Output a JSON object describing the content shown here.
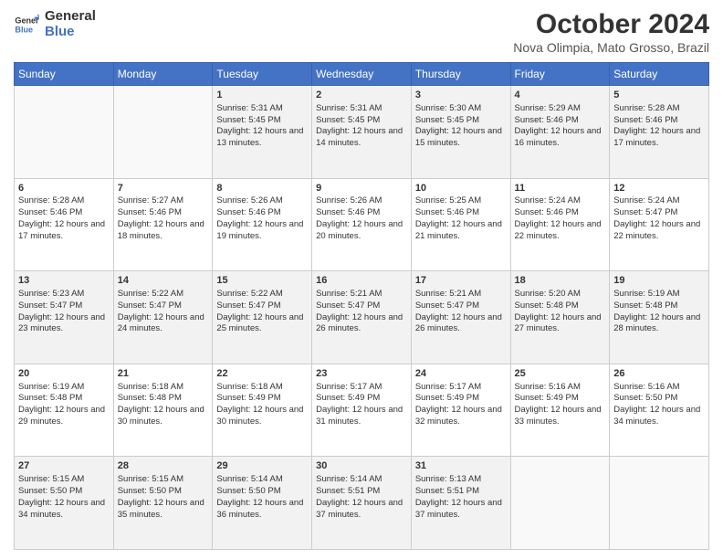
{
  "header": {
    "logo_line1": "General",
    "logo_line2": "Blue",
    "main_title": "October 2024",
    "subtitle": "Nova Olimpia, Mato Grosso, Brazil"
  },
  "days_of_week": [
    "Sunday",
    "Monday",
    "Tuesday",
    "Wednesday",
    "Thursday",
    "Friday",
    "Saturday"
  ],
  "weeks": [
    [
      {
        "day": "",
        "info": ""
      },
      {
        "day": "",
        "info": ""
      },
      {
        "day": "1",
        "info": "Sunrise: 5:31 AM\nSunset: 5:45 PM\nDaylight: 12 hours and 13 minutes."
      },
      {
        "day": "2",
        "info": "Sunrise: 5:31 AM\nSunset: 5:45 PM\nDaylight: 12 hours and 14 minutes."
      },
      {
        "day": "3",
        "info": "Sunrise: 5:30 AM\nSunset: 5:45 PM\nDaylight: 12 hours and 15 minutes."
      },
      {
        "day": "4",
        "info": "Sunrise: 5:29 AM\nSunset: 5:46 PM\nDaylight: 12 hours and 16 minutes."
      },
      {
        "day": "5",
        "info": "Sunrise: 5:28 AM\nSunset: 5:46 PM\nDaylight: 12 hours and 17 minutes."
      }
    ],
    [
      {
        "day": "6",
        "info": "Sunrise: 5:28 AM\nSunset: 5:46 PM\nDaylight: 12 hours and 17 minutes."
      },
      {
        "day": "7",
        "info": "Sunrise: 5:27 AM\nSunset: 5:46 PM\nDaylight: 12 hours and 18 minutes."
      },
      {
        "day": "8",
        "info": "Sunrise: 5:26 AM\nSunset: 5:46 PM\nDaylight: 12 hours and 19 minutes."
      },
      {
        "day": "9",
        "info": "Sunrise: 5:26 AM\nSunset: 5:46 PM\nDaylight: 12 hours and 20 minutes."
      },
      {
        "day": "10",
        "info": "Sunrise: 5:25 AM\nSunset: 5:46 PM\nDaylight: 12 hours and 21 minutes."
      },
      {
        "day": "11",
        "info": "Sunrise: 5:24 AM\nSunset: 5:46 PM\nDaylight: 12 hours and 22 minutes."
      },
      {
        "day": "12",
        "info": "Sunrise: 5:24 AM\nSunset: 5:47 PM\nDaylight: 12 hours and 22 minutes."
      }
    ],
    [
      {
        "day": "13",
        "info": "Sunrise: 5:23 AM\nSunset: 5:47 PM\nDaylight: 12 hours and 23 minutes."
      },
      {
        "day": "14",
        "info": "Sunrise: 5:22 AM\nSunset: 5:47 PM\nDaylight: 12 hours and 24 minutes."
      },
      {
        "day": "15",
        "info": "Sunrise: 5:22 AM\nSunset: 5:47 PM\nDaylight: 12 hours and 25 minutes."
      },
      {
        "day": "16",
        "info": "Sunrise: 5:21 AM\nSunset: 5:47 PM\nDaylight: 12 hours and 26 minutes."
      },
      {
        "day": "17",
        "info": "Sunrise: 5:21 AM\nSunset: 5:47 PM\nDaylight: 12 hours and 26 minutes."
      },
      {
        "day": "18",
        "info": "Sunrise: 5:20 AM\nSunset: 5:48 PM\nDaylight: 12 hours and 27 minutes."
      },
      {
        "day": "19",
        "info": "Sunrise: 5:19 AM\nSunset: 5:48 PM\nDaylight: 12 hours and 28 minutes."
      }
    ],
    [
      {
        "day": "20",
        "info": "Sunrise: 5:19 AM\nSunset: 5:48 PM\nDaylight: 12 hours and 29 minutes."
      },
      {
        "day": "21",
        "info": "Sunrise: 5:18 AM\nSunset: 5:48 PM\nDaylight: 12 hours and 30 minutes."
      },
      {
        "day": "22",
        "info": "Sunrise: 5:18 AM\nSunset: 5:49 PM\nDaylight: 12 hours and 30 minutes."
      },
      {
        "day": "23",
        "info": "Sunrise: 5:17 AM\nSunset: 5:49 PM\nDaylight: 12 hours and 31 minutes."
      },
      {
        "day": "24",
        "info": "Sunrise: 5:17 AM\nSunset: 5:49 PM\nDaylight: 12 hours and 32 minutes."
      },
      {
        "day": "25",
        "info": "Sunrise: 5:16 AM\nSunset: 5:49 PM\nDaylight: 12 hours and 33 minutes."
      },
      {
        "day": "26",
        "info": "Sunrise: 5:16 AM\nSunset: 5:50 PM\nDaylight: 12 hours and 34 minutes."
      }
    ],
    [
      {
        "day": "27",
        "info": "Sunrise: 5:15 AM\nSunset: 5:50 PM\nDaylight: 12 hours and 34 minutes."
      },
      {
        "day": "28",
        "info": "Sunrise: 5:15 AM\nSunset: 5:50 PM\nDaylight: 12 hours and 35 minutes."
      },
      {
        "day": "29",
        "info": "Sunrise: 5:14 AM\nSunset: 5:50 PM\nDaylight: 12 hours and 36 minutes."
      },
      {
        "day": "30",
        "info": "Sunrise: 5:14 AM\nSunset: 5:51 PM\nDaylight: 12 hours and 37 minutes."
      },
      {
        "day": "31",
        "info": "Sunrise: 5:13 AM\nSunset: 5:51 PM\nDaylight: 12 hours and 37 minutes."
      },
      {
        "day": "",
        "info": ""
      },
      {
        "day": "",
        "info": ""
      }
    ]
  ]
}
